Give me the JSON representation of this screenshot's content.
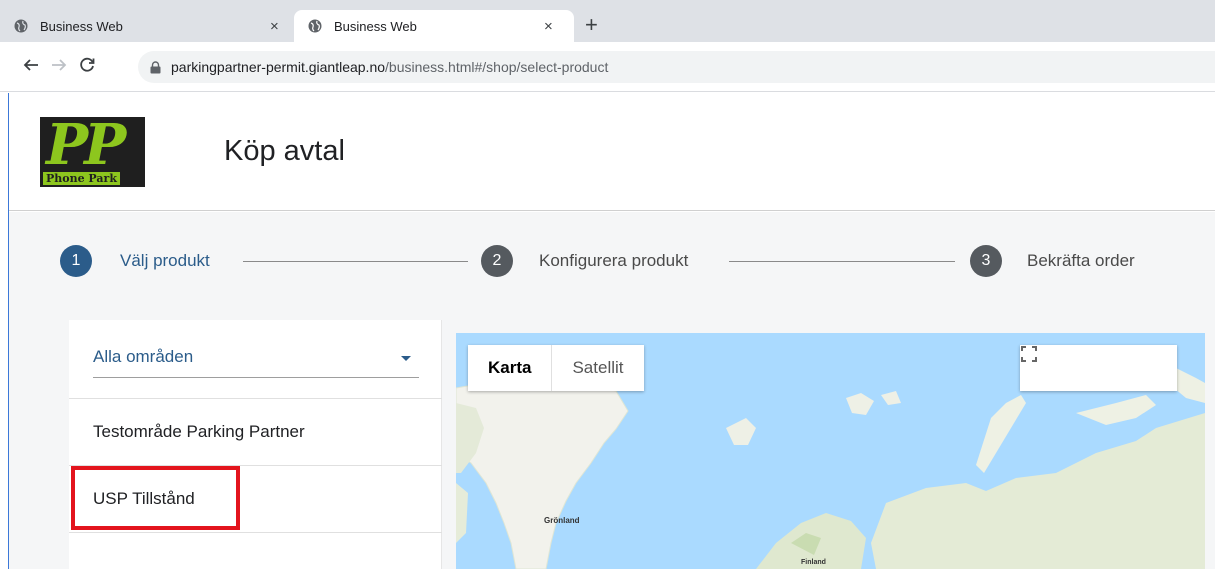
{
  "browser": {
    "tabs": [
      {
        "title": "Business Web",
        "active": false
      },
      {
        "title": "Business Web",
        "active": true
      }
    ],
    "tab_close_glyph": "×",
    "new_tab_glyph": "+",
    "url_host": "parkingpartner-permit.giantleap.no",
    "url_path": "/business.html#/shop/select-product",
    "icons": [
      "back-arrow-icon",
      "forward-arrow-icon",
      "reload-icon",
      "lock-icon",
      "globe-icon",
      "close-icon",
      "plus-icon"
    ]
  },
  "header": {
    "logo_text": "PP",
    "logo_subtext": "Phone Park",
    "title": "Köp avtal"
  },
  "stepper": {
    "steps": [
      {
        "number": "1",
        "label": "Välj produkt",
        "active": true
      },
      {
        "number": "2",
        "label": "Konfigurera produkt",
        "active": false
      },
      {
        "number": "3",
        "label": "Bekräfta order",
        "active": false
      }
    ]
  },
  "area_selector": {
    "value": "Alla områden"
  },
  "areas": [
    {
      "label": "Testområde Parking Partner"
    },
    {
      "label": "USP Tillstånd",
      "highlighted": true
    }
  ],
  "map": {
    "type_buttons": [
      "Karta",
      "Satellit"
    ],
    "selected_type": "Karta",
    "labels": [
      "Grönland",
      "Finland"
    ]
  },
  "colors": {
    "accent": "#2b5c8a",
    "inactive_step": "#555a5f",
    "highlight_border": "#e3141d",
    "logo_green": "#8dc61e",
    "water": "#aadaff",
    "land": "#e8eddf"
  }
}
